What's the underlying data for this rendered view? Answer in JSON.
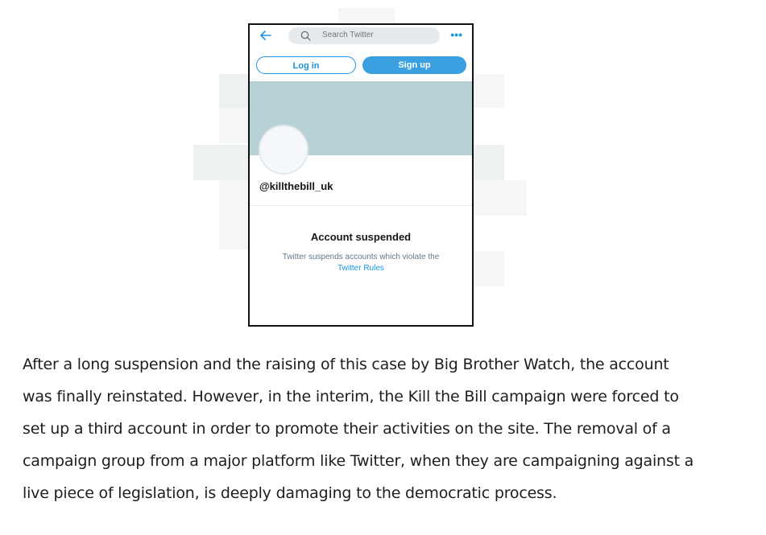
{
  "twitter_screenshot": {
    "search_placeholder": "Search Twitter",
    "login_label": "Log in",
    "signup_label": "Sign up",
    "handle": "@killthebill_uk",
    "status_title": "Account suspended",
    "status_desc_line1": "Twitter suspends accounts which violate the",
    "status_link": "Twitter Rules",
    "colors": {
      "accent": "#1b95e0",
      "banner": "#b7d1d6"
    },
    "icons": [
      "back-arrow-icon",
      "search-icon",
      "more-icon"
    ]
  },
  "article": {
    "lines": [
      "After a long suspension and the raising of this case by Big Brother Watch, the account",
      "was finally reinstated. However, in the interim, the Kill the Bill campaign were forced to",
      "set up a third account in order to promote their activities on the site. The removal of a",
      "campaign group from a major platform like Twitter, when they are campaigning against a",
      "live piece of legislation, is deeply damaging to the democratic process."
    ]
  }
}
